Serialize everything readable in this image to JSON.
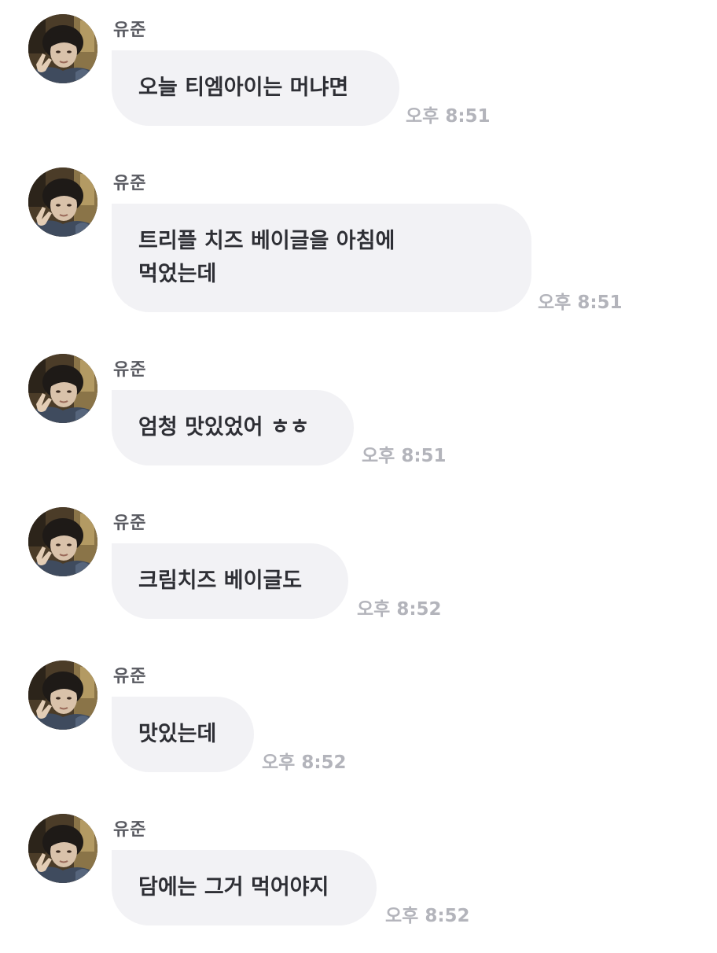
{
  "chat": {
    "messages": [
      {
        "sender": "유준",
        "avatar_icon": "profile-avatar-icon",
        "text": "오늘 티엠아이는 머냐면",
        "time": "오후 8:51"
      },
      {
        "sender": "유준",
        "avatar_icon": "profile-avatar-icon",
        "text": "트리플 치즈 베이글을 아침에\n먹었는데",
        "time": "오후 8:51"
      },
      {
        "sender": "유준",
        "avatar_icon": "profile-avatar-icon",
        "text": "엄청 맛있었어 ㅎㅎ",
        "time": "오후 8:51"
      },
      {
        "sender": "유준",
        "avatar_icon": "profile-avatar-icon",
        "text": "크림치즈 베이글도",
        "time": "오후 8:52"
      },
      {
        "sender": "유준",
        "avatar_icon": "profile-avatar-icon",
        "text": "맛있는데",
        "time": "오후 8:52"
      },
      {
        "sender": "유준",
        "avatar_icon": "profile-avatar-icon",
        "text": "담에는 그거 먹어야지",
        "time": "오후 8:52"
      }
    ]
  }
}
